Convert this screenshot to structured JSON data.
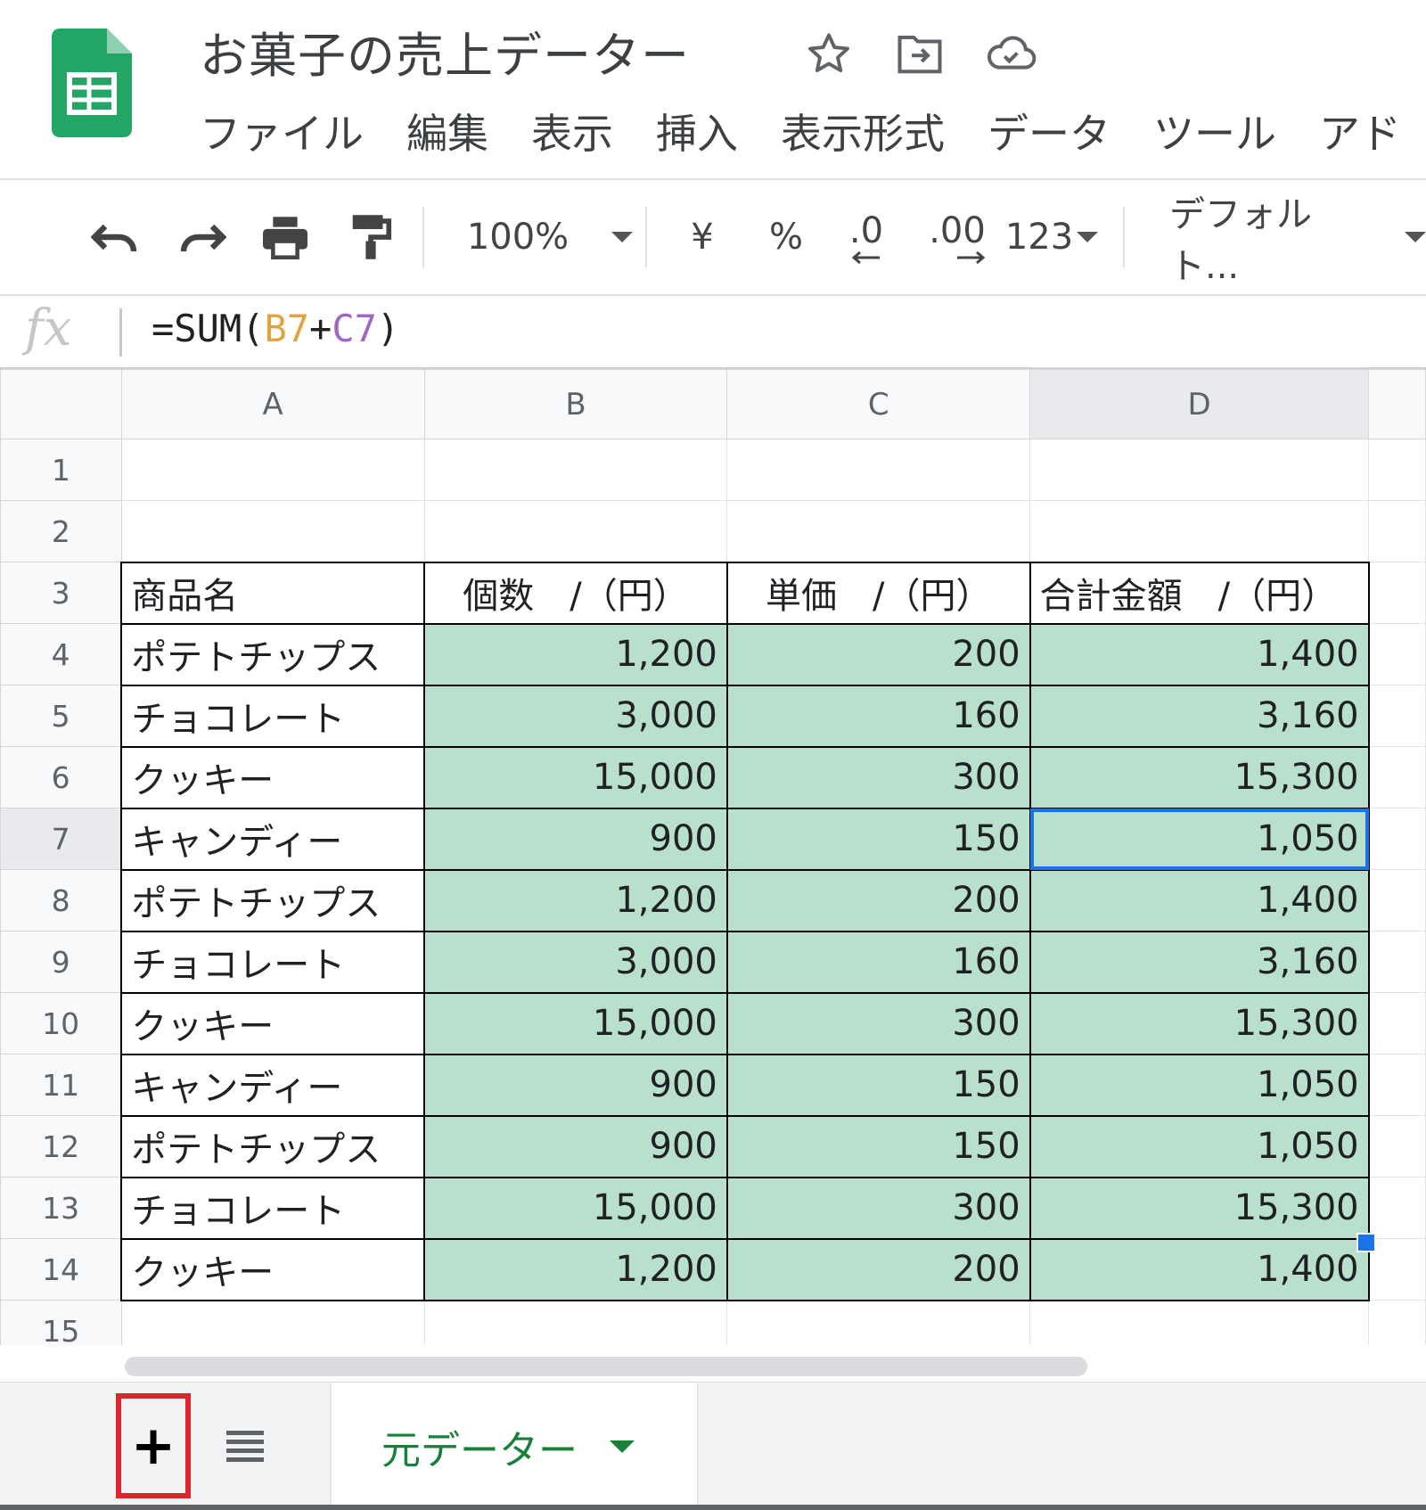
{
  "app": {
    "title": "お菓子の売上データー",
    "menu": [
      "ファイル",
      "編集",
      "表示",
      "挿入",
      "表示形式",
      "データ",
      "ツール",
      "アド"
    ]
  },
  "toolbar": {
    "zoom": "100%",
    "currency": "¥",
    "percent": "%",
    "dec_decrease": ".0",
    "dec_increase": ".00",
    "number_format": "123",
    "font": "デフォルト..."
  },
  "formula_bar": {
    "fx_label": "fx",
    "formula_prefix": "=SUM(",
    "ref1": "B7",
    "plus": "+",
    "ref2": "C7",
    "formula_suffix": ")"
  },
  "grid": {
    "columns": [
      "A",
      "B",
      "C",
      "D"
    ],
    "header_row": [
      "商品名",
      "個数　/（円）",
      "単価　/（円）",
      "合計金額　/（円）"
    ],
    "rows": [
      [
        "ポテトチップス",
        "1,200",
        "200",
        "1,400"
      ],
      [
        "チョコレート",
        "3,000",
        "160",
        "3,160"
      ],
      [
        "クッキー",
        "15,000",
        "300",
        "15,300"
      ],
      [
        "キャンディー",
        "900",
        "150",
        "1,050"
      ],
      [
        "ポテトチップス",
        "1,200",
        "200",
        "1,400"
      ],
      [
        "チョコレート",
        "3,000",
        "160",
        "3,160"
      ],
      [
        "クッキー",
        "15,000",
        "300",
        "15,300"
      ],
      [
        "キャンディー",
        "900",
        "150",
        "1,050"
      ],
      [
        "ポテトチップス",
        "900",
        "150",
        "1,050"
      ],
      [
        "チョコレート",
        "15,000",
        "300",
        "15,300"
      ],
      [
        "クッキー",
        "1,200",
        "200",
        "1,400"
      ]
    ],
    "row_numbers": [
      "1",
      "2",
      "3",
      "4",
      "5",
      "6",
      "7",
      "8",
      "9",
      "10",
      "11",
      "12",
      "13",
      "14",
      "15"
    ],
    "active_cell": "D7",
    "fill_color": "#b8e0cc",
    "selection_color": "#1a73e8"
  },
  "sheets": {
    "add_label": "+",
    "tabs": [
      {
        "name": "元データー"
      }
    ]
  },
  "colors": {
    "brand_green": "#0f9d58",
    "tab_text": "#188038",
    "highlight_red": "#e0242b"
  }
}
